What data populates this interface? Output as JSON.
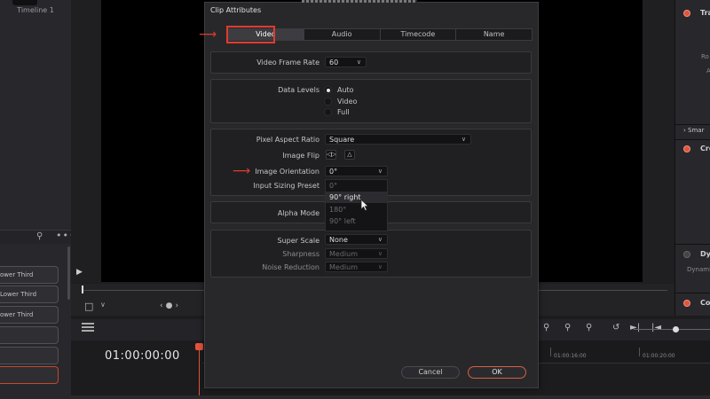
{
  "left_panel": {
    "timeline_label": "Timeline 1",
    "clips": [
      "ower Third",
      "Lower Third",
      "ower Third",
      "",
      "",
      ""
    ]
  },
  "right_panel": {
    "items": [
      "Tra",
      "Ro",
      "A",
      "Smar",
      "Cro",
      "Dyn",
      "Dynamic",
      "Co"
    ]
  },
  "timeline": {
    "timecode": "01:00:00:00",
    "ruler_ticks": [
      "01:00:16:00",
      "01:00:20:00"
    ]
  },
  "dialog": {
    "title": "Clip Attributes",
    "tabs": [
      "Video",
      "Audio",
      "Timecode",
      "Name"
    ],
    "active_tab": "Video",
    "video_frame_rate": {
      "label": "Video Frame Rate",
      "value": "60"
    },
    "data_levels": {
      "label": "Data Levels",
      "options": [
        "Auto",
        "Video",
        "Full"
      ],
      "selected": "Auto"
    },
    "pixel_aspect_ratio": {
      "label": "Pixel Aspect Ratio",
      "value": "Square"
    },
    "image_flip": {
      "label": "Image Flip"
    },
    "image_orientation": {
      "label": "Image Orientation",
      "value": "0°",
      "options": [
        "0°",
        "90° right",
        "180°",
        "90° left"
      ],
      "hovered": "90° right"
    },
    "input_sizing_preset": {
      "label": "Input Sizing Preset"
    },
    "alpha_mode": {
      "label": "Alpha Mode"
    },
    "super_scale": {
      "label": "Super Scale",
      "value": "None"
    },
    "sharpness": {
      "label": "Sharpness",
      "value": "Medium"
    },
    "noise_reduction": {
      "label": "Noise Reduction",
      "value": "Medium"
    },
    "cancel_label": "Cancel",
    "ok_label": "OK"
  },
  "colors": {
    "accent": "#e5533c",
    "annotation_red": "#e33a2e",
    "dialog_bg": "#28282b"
  },
  "icons": [
    "search-icon",
    "more-icon",
    "play-icon",
    "crop-icon",
    "chevron-down-icon",
    "prev-icon",
    "next-icon",
    "flip-horizontal-icon",
    "flip-vertical-icon",
    "cursor-icon"
  ]
}
